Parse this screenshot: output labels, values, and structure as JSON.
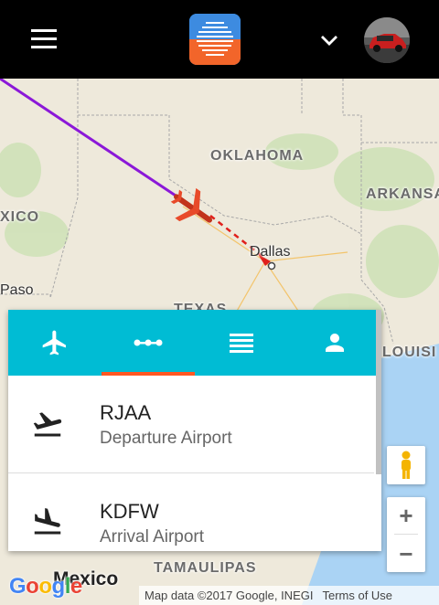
{
  "header": {
    "menu_icon": "hamburger-menu-icon",
    "logo_icon": "app-logo-icon",
    "dropdown_icon": "chevron-down-icon",
    "avatar_icon": "user-avatar"
  },
  "map": {
    "labels": {
      "oklahoma": "OKLAHOMA",
      "arkansas": "ARKANSA",
      "mexico_state": "XICO",
      "texas": "TEXAS",
      "louisiana": "LOUISI",
      "tamaulipas": "TAMAULIPAS",
      "mexico": "Mexico",
      "dallas": "Dallas",
      "el_paso": "Paso"
    },
    "route_color": "#8b18d8",
    "remaining_route_color": "#e0201b",
    "plane_color": "#e84a2a"
  },
  "panel": {
    "tabs": [
      {
        "name": "flight",
        "icon": "airplane-icon"
      },
      {
        "name": "route",
        "icon": "route-dots-icon"
      },
      {
        "name": "details",
        "icon": "list-icon"
      },
      {
        "name": "profile",
        "icon": "person-icon"
      }
    ],
    "active_tab": 1,
    "accent_color": "#00bcd4",
    "indicator_color": "#ff5722",
    "departure": {
      "code": "RJAA",
      "label": "Departure Airport",
      "icon": "takeoff-icon"
    },
    "arrival": {
      "code": "KDFW",
      "label": "Arrival Airport",
      "icon": "landing-icon"
    }
  },
  "controls": {
    "zoom_in": "+",
    "zoom_out": "−",
    "pegman_icon": "street-view-icon"
  },
  "footer": {
    "google": "Google",
    "map_data": "Map data ©2017 Google, INEGI",
    "terms": "Terms of Use"
  }
}
